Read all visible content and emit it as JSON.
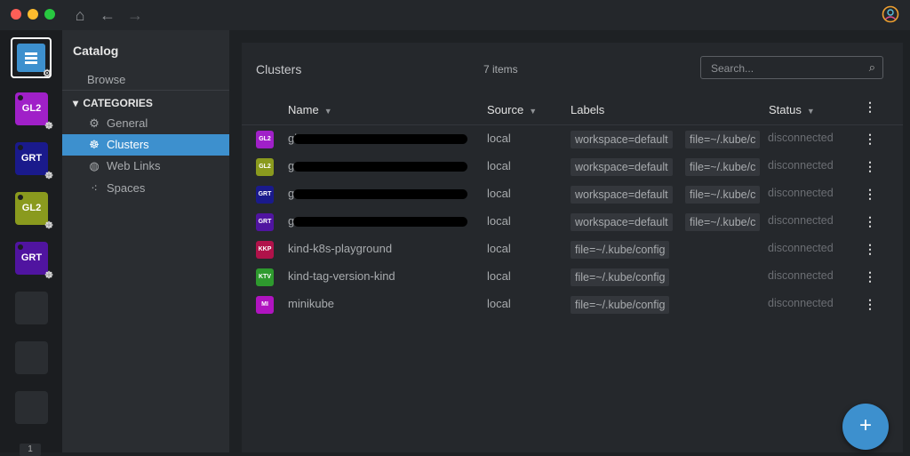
{
  "window": {
    "nav": {
      "home_icon": "home-icon",
      "back_icon": "arrow-left-icon",
      "forward_icon": "arrow-right-icon"
    },
    "colors": {
      "close": "#ff5f57",
      "minimize": "#febc2e",
      "maximize": "#28c840"
    }
  },
  "hotbar": {
    "items": [
      {
        "label": "GL2",
        "color": "#a020c8"
      },
      {
        "label": "GRT",
        "color": "#1a1a8c"
      },
      {
        "label": "GL2",
        "color": "#8a9a1e"
      },
      {
        "label": "GRT",
        "color": "#5014a0"
      }
    ],
    "page": "1"
  },
  "sidebar": {
    "title": "Catalog",
    "browse": "Browse",
    "categories_label": "CATEGORIES",
    "items": [
      {
        "label": "General",
        "icon": "gear-icon"
      },
      {
        "label": "Clusters",
        "icon": "helm-icon"
      },
      {
        "label": "Web Links",
        "icon": "globe-icon"
      },
      {
        "label": "Spaces",
        "icon": "dots-icon"
      }
    ]
  },
  "panel": {
    "title": "Clusters",
    "count": "7 items",
    "search_placeholder": "Search...",
    "columns": {
      "name": "Name",
      "source": "Source",
      "labels": "Labels",
      "status": "Status"
    }
  },
  "rows": [
    {
      "avatar": "GL2",
      "avatar_color": "#a020c8",
      "name": "gl",
      "source": "local",
      "labels": [
        "workspace=default",
        "file=~/.kube/c"
      ],
      "status": "disconnected"
    },
    {
      "avatar": "GL2",
      "avatar_color": "#8a9a1e",
      "name": "g",
      "source": "local",
      "labels": [
        "workspace=default",
        "file=~/.kube/c"
      ],
      "status": "disconnected"
    },
    {
      "avatar": "GRT",
      "avatar_color": "#1a1a8c",
      "name": "g",
      "source": "local",
      "labels": [
        "workspace=default",
        "file=~/.kube/c"
      ],
      "status": "disconnected"
    },
    {
      "avatar": "GRT",
      "avatar_color": "#5014a0",
      "name": "g",
      "source": "local",
      "labels": [
        "workspace=default",
        "file=~/.kube/c"
      ],
      "status": "disconnected"
    },
    {
      "avatar": "KKP",
      "avatar_color": "#b0124a",
      "name": "kind-k8s-playground",
      "source": "local",
      "labels": [
        "file=~/.kube/config"
      ],
      "status": "disconnected"
    },
    {
      "avatar": "KTV",
      "avatar_color": "#2e9a2e",
      "name": "kind-tag-version-kind",
      "source": "local",
      "labels": [
        "file=~/.kube/config"
      ],
      "status": "disconnected"
    },
    {
      "avatar": "MI",
      "avatar_color": "#b014c0",
      "name": "minikube",
      "source": "local",
      "labels": [
        "file=~/.kube/config"
      ],
      "status": "disconnected"
    }
  ],
  "fab": {
    "label": "+"
  }
}
